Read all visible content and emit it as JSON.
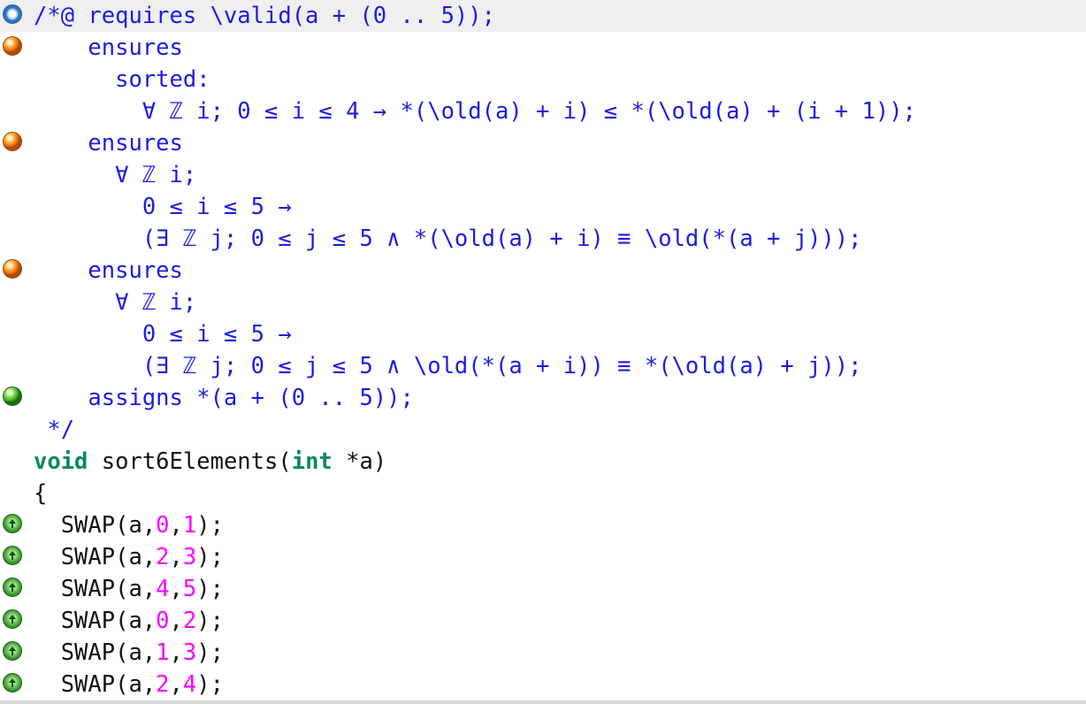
{
  "editor": {
    "lines": [
      {
        "text": "/*@ requires \\valid(a + (0 .. 5));",
        "status": "open-icon"
      },
      {
        "text": "    ensures",
        "status": "orange-status-icon"
      },
      {
        "text": "      sorted:",
        "status": ""
      },
      {
        "text": "        ∀ ℤ i; 0 ≤ i ≤ 4 → *(\\old(a) + i) ≤ *(\\old(a) + (i + 1));",
        "status": ""
      },
      {
        "text": "    ensures",
        "status": "orange-status-icon"
      },
      {
        "text": "      ∀ ℤ i;",
        "status": ""
      },
      {
        "text": "        0 ≤ i ≤ 5 →",
        "status": ""
      },
      {
        "text": "        (∃ ℤ j; 0 ≤ j ≤ 5 ∧ *(\\old(a) + i) ≡ \\old(*(a + j)));",
        "status": ""
      },
      {
        "text": "    ensures",
        "status": "orange-status-icon"
      },
      {
        "text": "      ∀ ℤ i;",
        "status": ""
      },
      {
        "text": "        0 ≤ i ≤ 5 →",
        "status": ""
      },
      {
        "text": "        (∃ ℤ j; 0 ≤ j ≤ 5 ∧ \\old(*(a + i)) ≡ *(\\old(a) + j));",
        "status": ""
      },
      {
        "text": "    assigns *(a + (0 .. 5));",
        "status": "green-status-icon"
      },
      {
        "text": " */",
        "status": ""
      },
      {
        "kw": "void",
        "rest1": " sort6Elements(",
        "kw2": "int",
        "rest2": " *a)",
        "status": ""
      },
      {
        "text": "{",
        "status": ""
      },
      {
        "call": "  SWAP(a,",
        "n1": "0",
        "n2": "1",
        "status": "green-arrow-icon"
      },
      {
        "call": "  SWAP(a,",
        "n1": "2",
        "n2": "3",
        "status": "green-arrow-icon"
      },
      {
        "call": "  SWAP(a,",
        "n1": "4",
        "n2": "5",
        "status": "green-arrow-icon"
      },
      {
        "call": "  SWAP(a,",
        "n1": "0",
        "n2": "2",
        "status": "green-arrow-icon"
      },
      {
        "call": "  SWAP(a,",
        "n1": "1",
        "n2": "3",
        "status": "green-arrow-icon"
      },
      {
        "call": "  SWAP(a,",
        "n1": "2",
        "n2": "4",
        "status": "green-arrow-icon"
      }
    ],
    "swap_comma": ",",
    "swap_close": ");"
  },
  "colors": {
    "acsl": "#1c1ce0",
    "keyword": "#0a8a5e",
    "number": "#ff00ff",
    "plain": "#111111",
    "current_line_bg": "#efefef"
  }
}
